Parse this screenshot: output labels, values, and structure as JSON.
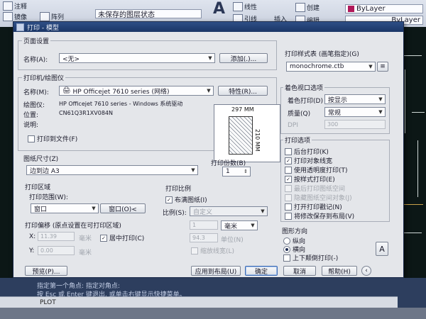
{
  "ribbon": {
    "row1_left": "注释",
    "row2_left": "镜像",
    "row2_mid": "阵列",
    "layer_state": "未保存的图层状态",
    "big_text": "A",
    "text_label": "文字",
    "linear_label": "线性",
    "leader_label": "引线",
    "insert_label": "插入",
    "create_label": "创建",
    "edit_label": "编辑",
    "bylayer": "ByLayer",
    "bylayer2": "ByLayer"
  },
  "dialog": {
    "title": "打印 - 模型",
    "page_setup": {
      "group": "页面设置",
      "name_label": "名称(A):",
      "name_value": "<无>",
      "add_button": "添加(.)..."
    },
    "printer": {
      "group": "打印机/绘图仪",
      "name_label": "名称(M):",
      "name_value": "HP Officejet 7610 series (网络)",
      "properties_button": "特性(R)...",
      "plotter_label": "绘图仪:",
      "plotter_value": "HP Officejet 7610 series - Windows 系统驱动",
      "location_label": "位置:",
      "location_value": "CN61Q3R1XV084N",
      "description_label": "说明:",
      "plot_to_file": "打印到文件(F)",
      "plot_to_file_checked": false,
      "preview_width": "297 MM",
      "preview_height": "210 MM"
    },
    "paper": {
      "group": "图纸尺寸(Z)",
      "value": "边到边 A3"
    },
    "copies": {
      "label": "打印份数(B)",
      "value": "1"
    },
    "plot_area": {
      "group": "打印区域",
      "range_label": "打印范围(W):",
      "range_value": "窗口",
      "window_button": "窗口(O)<"
    },
    "plot_scale": {
      "group": "打印比例",
      "fit_paper": "布满图纸(I)",
      "fit_paper_checked": true,
      "scale_label": "比例(S):",
      "scale_value": "自定义",
      "unit_value": "毫米",
      "scale_a": "1",
      "scale_b": "94.3",
      "unit2": "单位(N)",
      "scale_lineweights": "缩放线宽(L)"
    },
    "plot_offset": {
      "group": "打印偏移 (原点设置在可打印区域)",
      "x_label": "X:",
      "x_value": "11.39",
      "y_label": "Y:",
      "y_value": "0.00",
      "unit": "毫米",
      "center": "居中打印(C)",
      "center_checked": true
    },
    "plot_style": {
      "group": "打印样式表 (画笔指定)(G)",
      "value": "monochrome.ctb"
    },
    "shaded_viewport": {
      "group": "着色视口选项",
      "shade_label": "着色打印(D)",
      "shade_value": "按显示",
      "quality_label": "质量(Q)",
      "quality_value": "常规",
      "dpi_label": "DPI",
      "dpi_value": "300"
    },
    "plot_options": {
      "group": "打印选项",
      "items": [
        {
          "label": "后台打印(K)",
          "checked": false,
          "disabled": false
        },
        {
          "label": "打印对象线宽",
          "checked": true,
          "disabled": false
        },
        {
          "label": "使用透明度打印(T)",
          "checked": false,
          "disabled": false
        },
        {
          "label": "按样式打印(E)",
          "checked": true,
          "disabled": false
        },
        {
          "label": "最后打印图纸空间",
          "checked": false,
          "disabled": true
        },
        {
          "label": "隐藏图纸空间对象(J)",
          "checked": false,
          "disabled": true
        },
        {
          "label": "打开打印戳记(N)",
          "checked": false,
          "disabled": false
        },
        {
          "label": "将修改保存到布局(V)",
          "checked": false,
          "disabled": false
        }
      ]
    },
    "orientation": {
      "group": "图形方向",
      "portrait": "纵向",
      "landscape": "横向",
      "selected": "landscape",
      "upside_down": "上下颠倒打印(-)"
    },
    "footer": {
      "preview_button": "预览(P)...",
      "apply_button": "应用到布局(U)",
      "ok_button": "确定",
      "cancel_button": "取消",
      "help_button": "帮助(H)"
    }
  },
  "command": {
    "line1": "指定第一个角点: 指定对角点:",
    "line2": "按 Esc 或 Enter 键退出, 或单击右键显示快捷菜单。",
    "input_value": "PLOT"
  }
}
